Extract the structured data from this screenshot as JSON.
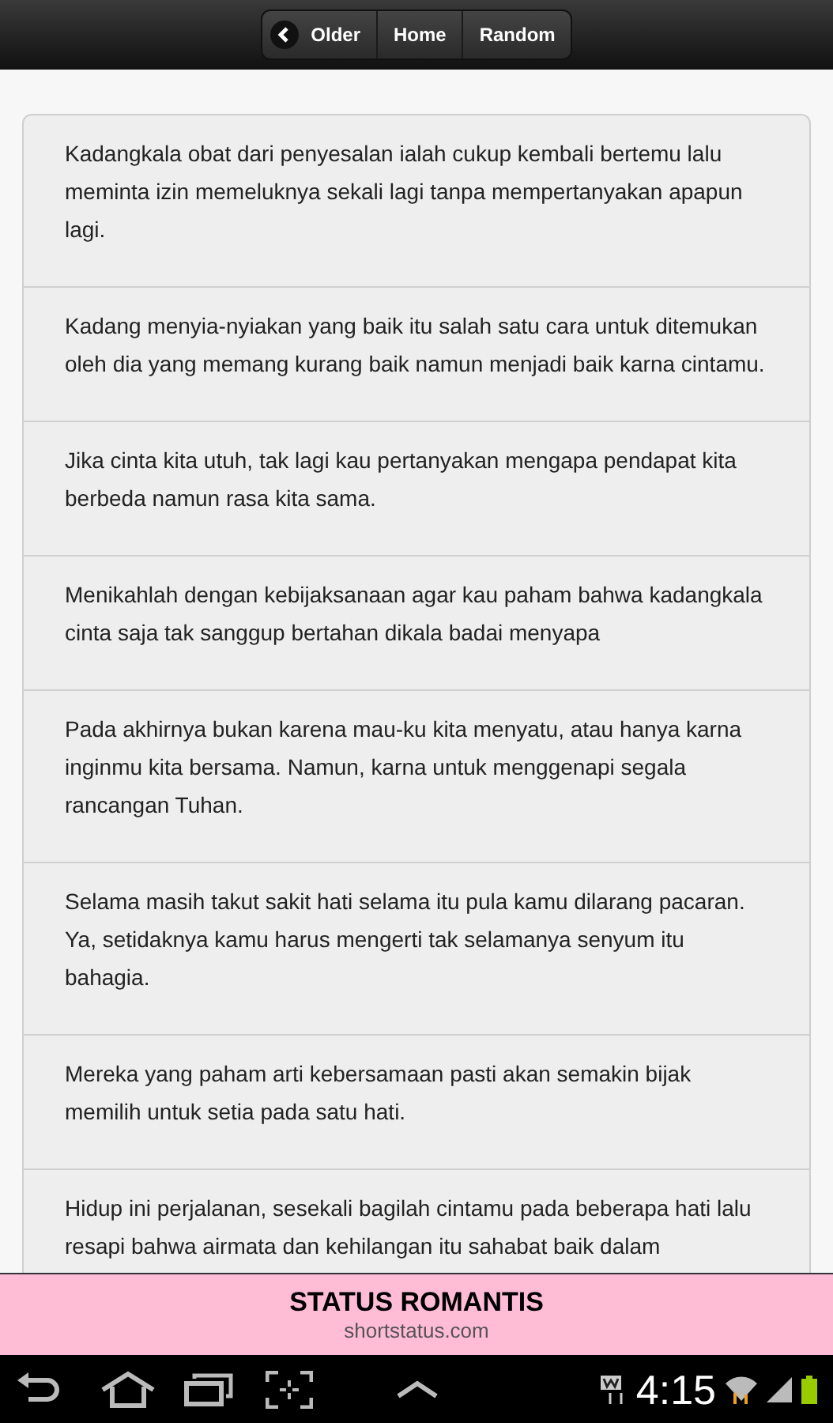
{
  "nav": {
    "buttons": [
      {
        "label": "Older",
        "kind": "back"
      },
      {
        "label": "Home",
        "kind": "plain"
      },
      {
        "label": "Random",
        "kind": "plain"
      }
    ]
  },
  "quotes": [
    "Kadangkala obat dari penyesalan ialah cukup kembali bertemu lalu meminta izin memeluknya sekali lagi tanpa mempertanyakan apapun lagi.",
    "Kadang menyia-nyiakan yang baik itu salah satu cara untuk ditemukan oleh dia yang memang kurang baik namun menjadi baik karna cintamu.",
    "Jika cinta kita utuh, tak lagi kau pertanyakan mengapa pendapat kita berbeda namun rasa kita sama.",
    "Menikahlah dengan kebijaksanaan agar kau paham bahwa kadangkala cinta saja tak sanggup bertahan dikala badai menyapa",
    "Pada akhirnya bukan karena mau-ku kita menyatu, atau hanya karna inginmu kita bersama. Namun, karna untuk menggenapi segala rancangan Tuhan.",
    "Selama masih takut sakit hati selama itu pula kamu dilarang pacaran. Ya, setidaknya kamu harus mengerti tak selamanya senyum itu bahagia.",
    "Mereka yang paham arti kebersamaan pasti akan semakin bijak memilih untuk setia pada satu hati.",
    "Hidup ini perjalanan, sesekali bagilah cintamu pada beberapa hati lalu resapi bahwa airmata dan kehilangan itu sahabat baik dalam"
  ],
  "banner": {
    "title": "STATUS ROMANTIS",
    "subtitle": "shortstatus.com"
  },
  "status_bar": {
    "time": "4:15"
  }
}
